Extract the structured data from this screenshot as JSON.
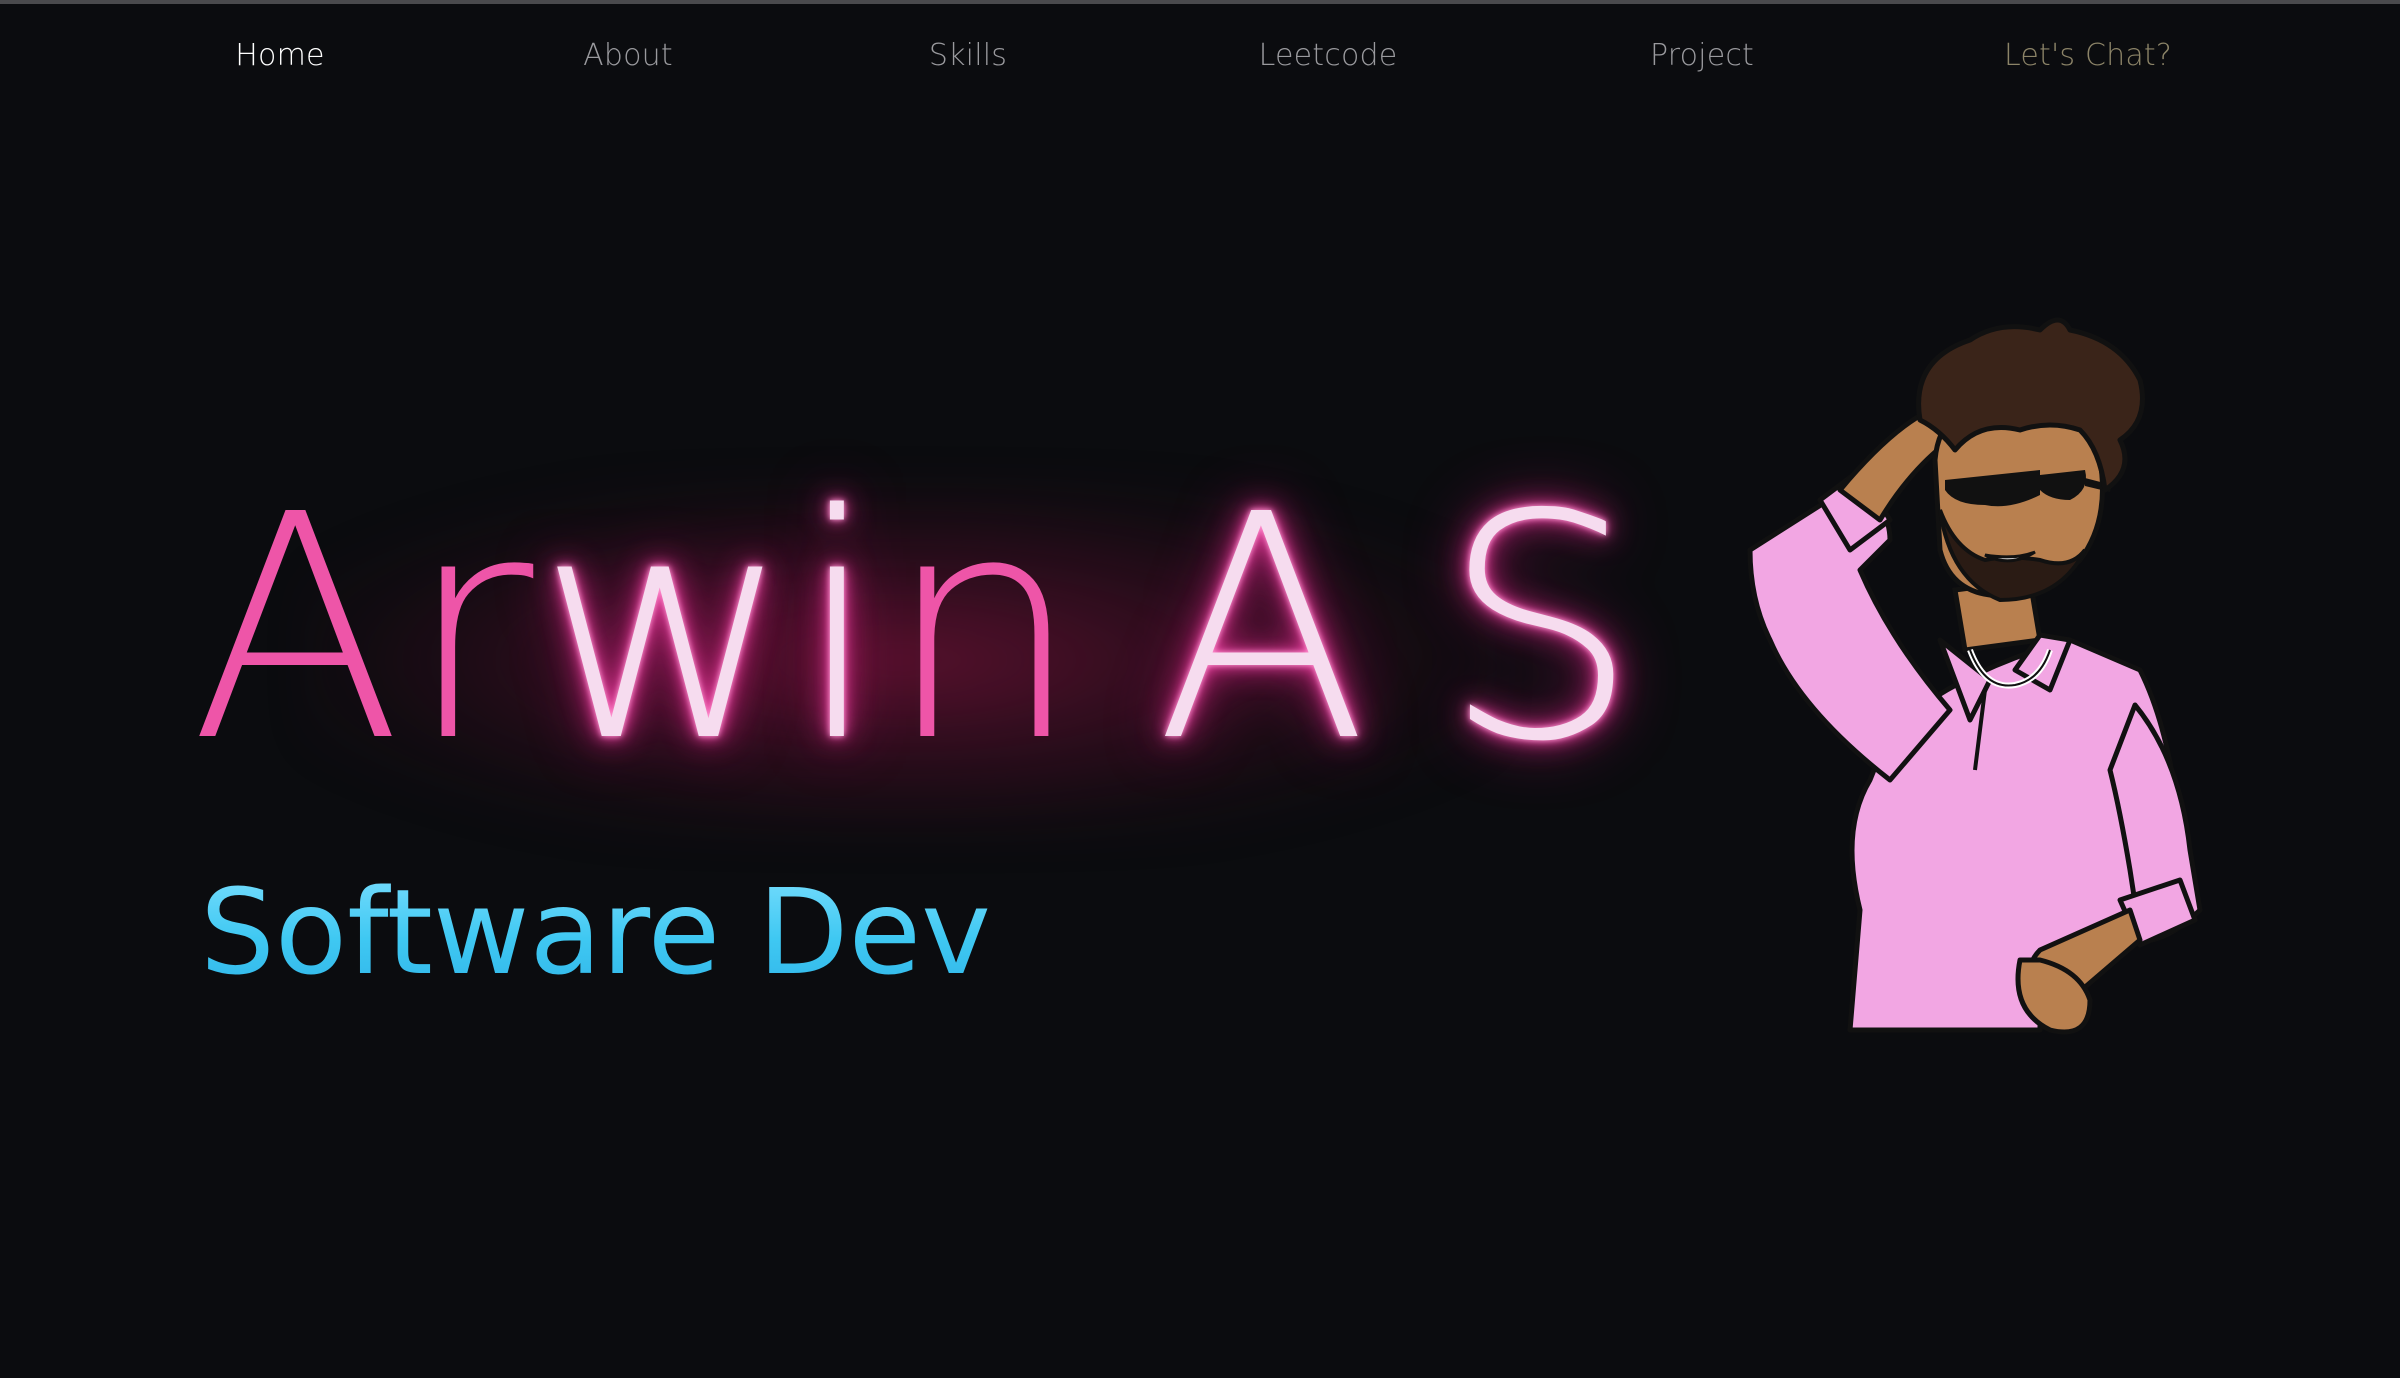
{
  "nav": {
    "items": [
      {
        "label": "Home",
        "active": true
      },
      {
        "label": "About"
      },
      {
        "label": "Skills"
      },
      {
        "label": "Leetcode"
      },
      {
        "label": "Project"
      },
      {
        "label": "Let's Chat?"
      }
    ]
  },
  "hero": {
    "name_letters": [
      "A",
      "r",
      "w",
      "i",
      "n",
      "A",
      "S"
    ],
    "role": "Software Dev"
  },
  "avatar": {
    "icon": "cartoon-developer-avatar"
  },
  "colors": {
    "background": "#0b0c0f",
    "name_pink": "#ee55a8",
    "name_neon": "#f6dcef",
    "role_cyan": "#3fc8f2",
    "shirt": "#f2a6e3",
    "skin": "#b9804f",
    "hair": "#3a2419",
    "chat_link": "#8c8468"
  }
}
